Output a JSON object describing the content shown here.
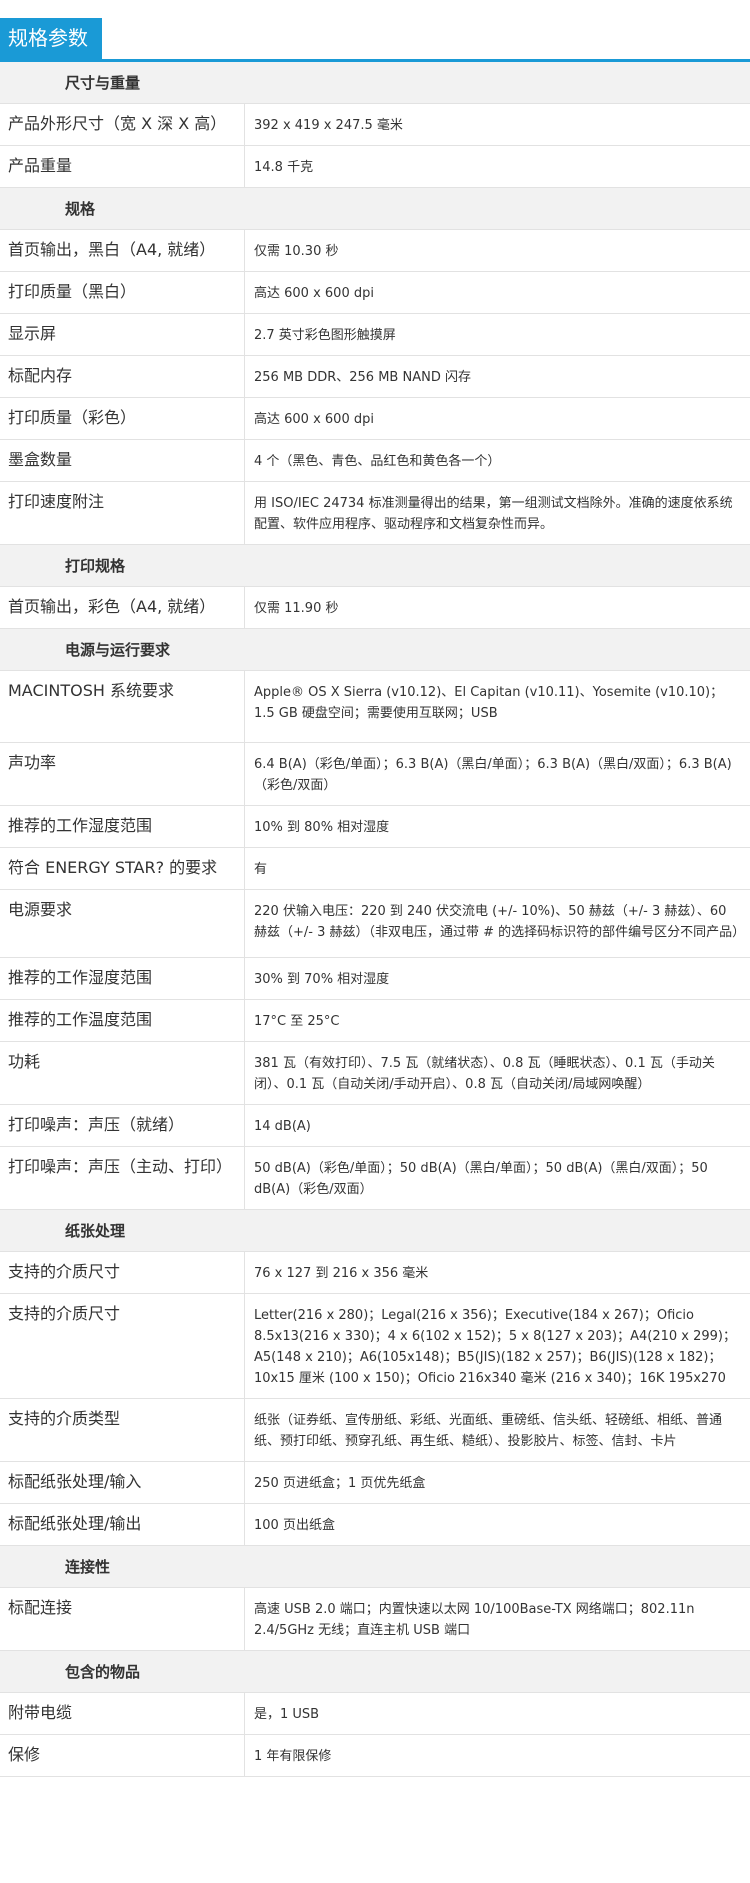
{
  "header": {
    "title": "规格参数"
  },
  "sections": [
    {
      "title": "尺寸与重量",
      "rows": [
        {
          "label": "产品外形尺寸（宽 X 深 X 高）",
          "value": "392 x 419 x 247.5 毫米"
        },
        {
          "label": "产品重量",
          "value": "14.8 千克"
        }
      ]
    },
    {
      "title": "规格",
      "rows": [
        {
          "label": "首页输出，黑白（A4, 就绪）",
          "value": "仅需 10.30 秒"
        },
        {
          "label": "打印质量（黑白）",
          "value": "高达 600 x 600 dpi"
        },
        {
          "label": "显示屏",
          "value": "2.7 英寸彩色图形触摸屏"
        },
        {
          "label": "标配内存",
          "value": "256 MB DDR、256 MB NAND 闪存"
        },
        {
          "label": "打印质量（彩色）",
          "value": "高达 600 x 600 dpi"
        },
        {
          "label": "墨盒数量",
          "value": "4 个（黑色、青色、品红色和黄色各一个）"
        },
        {
          "label": "打印速度附注",
          "value": "用 ISO/IEC 24734 标准测量得出的结果，第一组测试文档除外。准确的速度依系统配置、软件应用程序、驱动程序和文档复杂性而异。"
        }
      ]
    },
    {
      "title": "打印规格",
      "rows": [
        {
          "label": "首页输出，彩色（A4, 就绪）",
          "value": "仅需 11.90 秒"
        }
      ]
    },
    {
      "title": "电源与运行要求",
      "rows": [
        {
          "label": "MACINTOSH 系统要求",
          "value": "Apple® OS X Sierra (v10.12)、El Capitan (v10.11)、Yosemite (v10.10)；1.5 GB 硬盘空间；需要使用互联网；USB"
        },
        {
          "label": "声功率",
          "value": "6.4 B(A)（彩色/单面）；6.3 B(A)（黑白/单面）；6.3 B(A)（黑白/双面）；6.3 B(A)（彩色/双面）"
        },
        {
          "label": "推荐的工作湿度范围",
          "value": "10% 到 80% 相对湿度"
        },
        {
          "label": "符合 ENERGY STAR? 的要求",
          "value": "有"
        },
        {
          "label": "电源要求",
          "value": "220 伏输入电压：220 到 240 伏交流电 (+/- 10%)、50 赫兹（+/- 3 赫兹）、60 赫兹（+/- 3 赫兹）（非双电压，通过带 # 的选择码标识符的部件编号区分不同产品）"
        },
        {
          "label": "推荐的工作湿度范围",
          "value": "30% 到 70% 相对湿度"
        },
        {
          "label": "推荐的工作温度范围",
          "value": "17°C 至 25°C"
        },
        {
          "label": "功耗",
          "value": "381 瓦（有效打印）、7.5 瓦（就绪状态）、0.8 瓦（睡眠状态）、0.1 瓦（手动关闭）、0.1 瓦（自动关闭/手动开启）、0.8 瓦（自动关闭/局域网唤醒）"
        },
        {
          "label": "打印噪声：声压（就绪）",
          "value": "14 dB(A)"
        },
        {
          "label": "打印噪声：声压（主动、打印）",
          "value": "50 dB(A)（彩色/单面）；50 dB(A)（黑白/单面）；50 dB(A)（黑白/双面）；50 dB(A)（彩色/双面）"
        }
      ]
    },
    {
      "title": "纸张处理",
      "rows": [
        {
          "label": "支持的介质尺寸",
          "value": "76 x 127 到 216 x 356 毫米"
        },
        {
          "label": "支持的介质尺寸",
          "value": "Letter(216 x 280)；Legal(216 x 356)；Executive(184 x 267)；Oficio 8.5x13(216 x 330)；4 x 6(102 x 152)；5 x 8(127 x 203)；A4(210 x 299)；A5(148 x 210)；A6(105x148)；B5(JIS)(182 x 257)；B6(JIS)(128 x 182)；10x15 厘米 (100 x 150)；Oficio 216x340 毫米 (216 x 340)；16K 195x270"
        },
        {
          "label": "支持的介质类型",
          "value": "纸张（证券纸、宣传册纸、彩纸、光面纸、重磅纸、信头纸、轻磅纸、相纸、普通纸、预打印纸、预穿孔纸、再生纸、糙纸）、投影胶片、标签、信封、卡片"
        },
        {
          "label": "标配纸张处理/输入",
          "value": "250 页进纸盒；1 页优先纸盒"
        },
        {
          "label": "标配纸张处理/输出",
          "value": "100 页出纸盒"
        }
      ]
    },
    {
      "title": "连接性",
      "rows": [
        {
          "label": "标配连接",
          "value": "高速 USB 2.0 端口；内置快速以太网 10/100Base-TX 网络端口；802.11n 2.4/5GHz 无线；直连主机 USB 端口"
        }
      ]
    },
    {
      "title": "包含的物品",
      "rows": [
        {
          "label": "附带电缆",
          "value": "是，1 USB"
        },
        {
          "label": "保修",
          "value": "1 年有限保修"
        }
      ]
    }
  ]
}
